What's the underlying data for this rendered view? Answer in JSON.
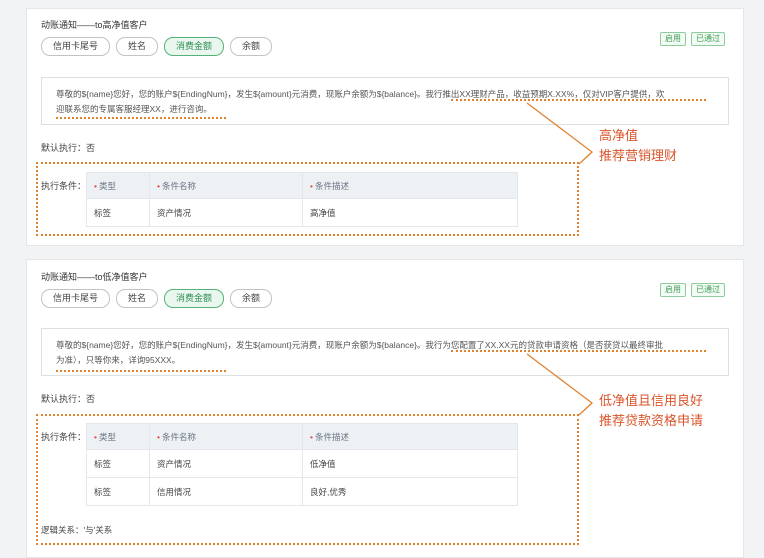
{
  "rule1": {
    "title": "动账通知——to高净值客户",
    "tags": [
      "信用卡尾号",
      "姓名",
      "消费金额",
      "余额"
    ],
    "active_tag": "消费金额",
    "badges": [
      "启用",
      "已通过"
    ],
    "message_line1": "尊敬的${name}您好，您的账户${EndingNum}，发生${amount}元消费，现账户余额为${balance}。我行推出XX理财产品，收益预期X.XX%，仅对VIP客户提供，欢",
    "message_line2": "迎联系您的专属客服经理XX，进行咨询。",
    "default_label": "默认执行：",
    "default_value": "否",
    "cond_label": "执行条件：",
    "headers": [
      "类型",
      "条件名称",
      "条件描述"
    ],
    "rows": [
      [
        "标签",
        "资产情况",
        "高净值"
      ]
    ]
  },
  "rule2": {
    "title": "动账通知——to低净值客户",
    "tags": [
      "信用卡尾号",
      "姓名",
      "消费金额",
      "余额"
    ],
    "active_tag": "消费金额",
    "badges": [
      "启用",
      "已通过"
    ],
    "message_line1": "尊敬的${name}您好，您的账户${EndingNum}，发生${amount}元消费，现账户余额为${balance}。我行为您配置了XX.XX元的贷款申请资格（是否获贷以最终审批",
    "message_line2": "为准），只等你来，详询95XXX。",
    "default_label": "默认执行：",
    "default_value": "否",
    "cond_label": "执行条件：",
    "headers": [
      "类型",
      "条件名称",
      "条件描述"
    ],
    "rows": [
      [
        "标签",
        "资产情况",
        "低净值"
      ],
      [
        "标签",
        "信用情况",
        "良好,优秀"
      ]
    ],
    "logic_label": "逻辑关系：",
    "logic_value": "'与'关系"
  },
  "annotations": {
    "a1_line1": "高净值",
    "a1_line2": "推荐营销理财",
    "a2_line1": "低净值且信用良好",
    "a2_line2": "推荐贷款资格申请"
  },
  "colors": {
    "accent_green": "#55b37a",
    "annotation_orange": "#e0832f",
    "annotation_text": "#d9542a",
    "required_red": "#e0473f"
  }
}
